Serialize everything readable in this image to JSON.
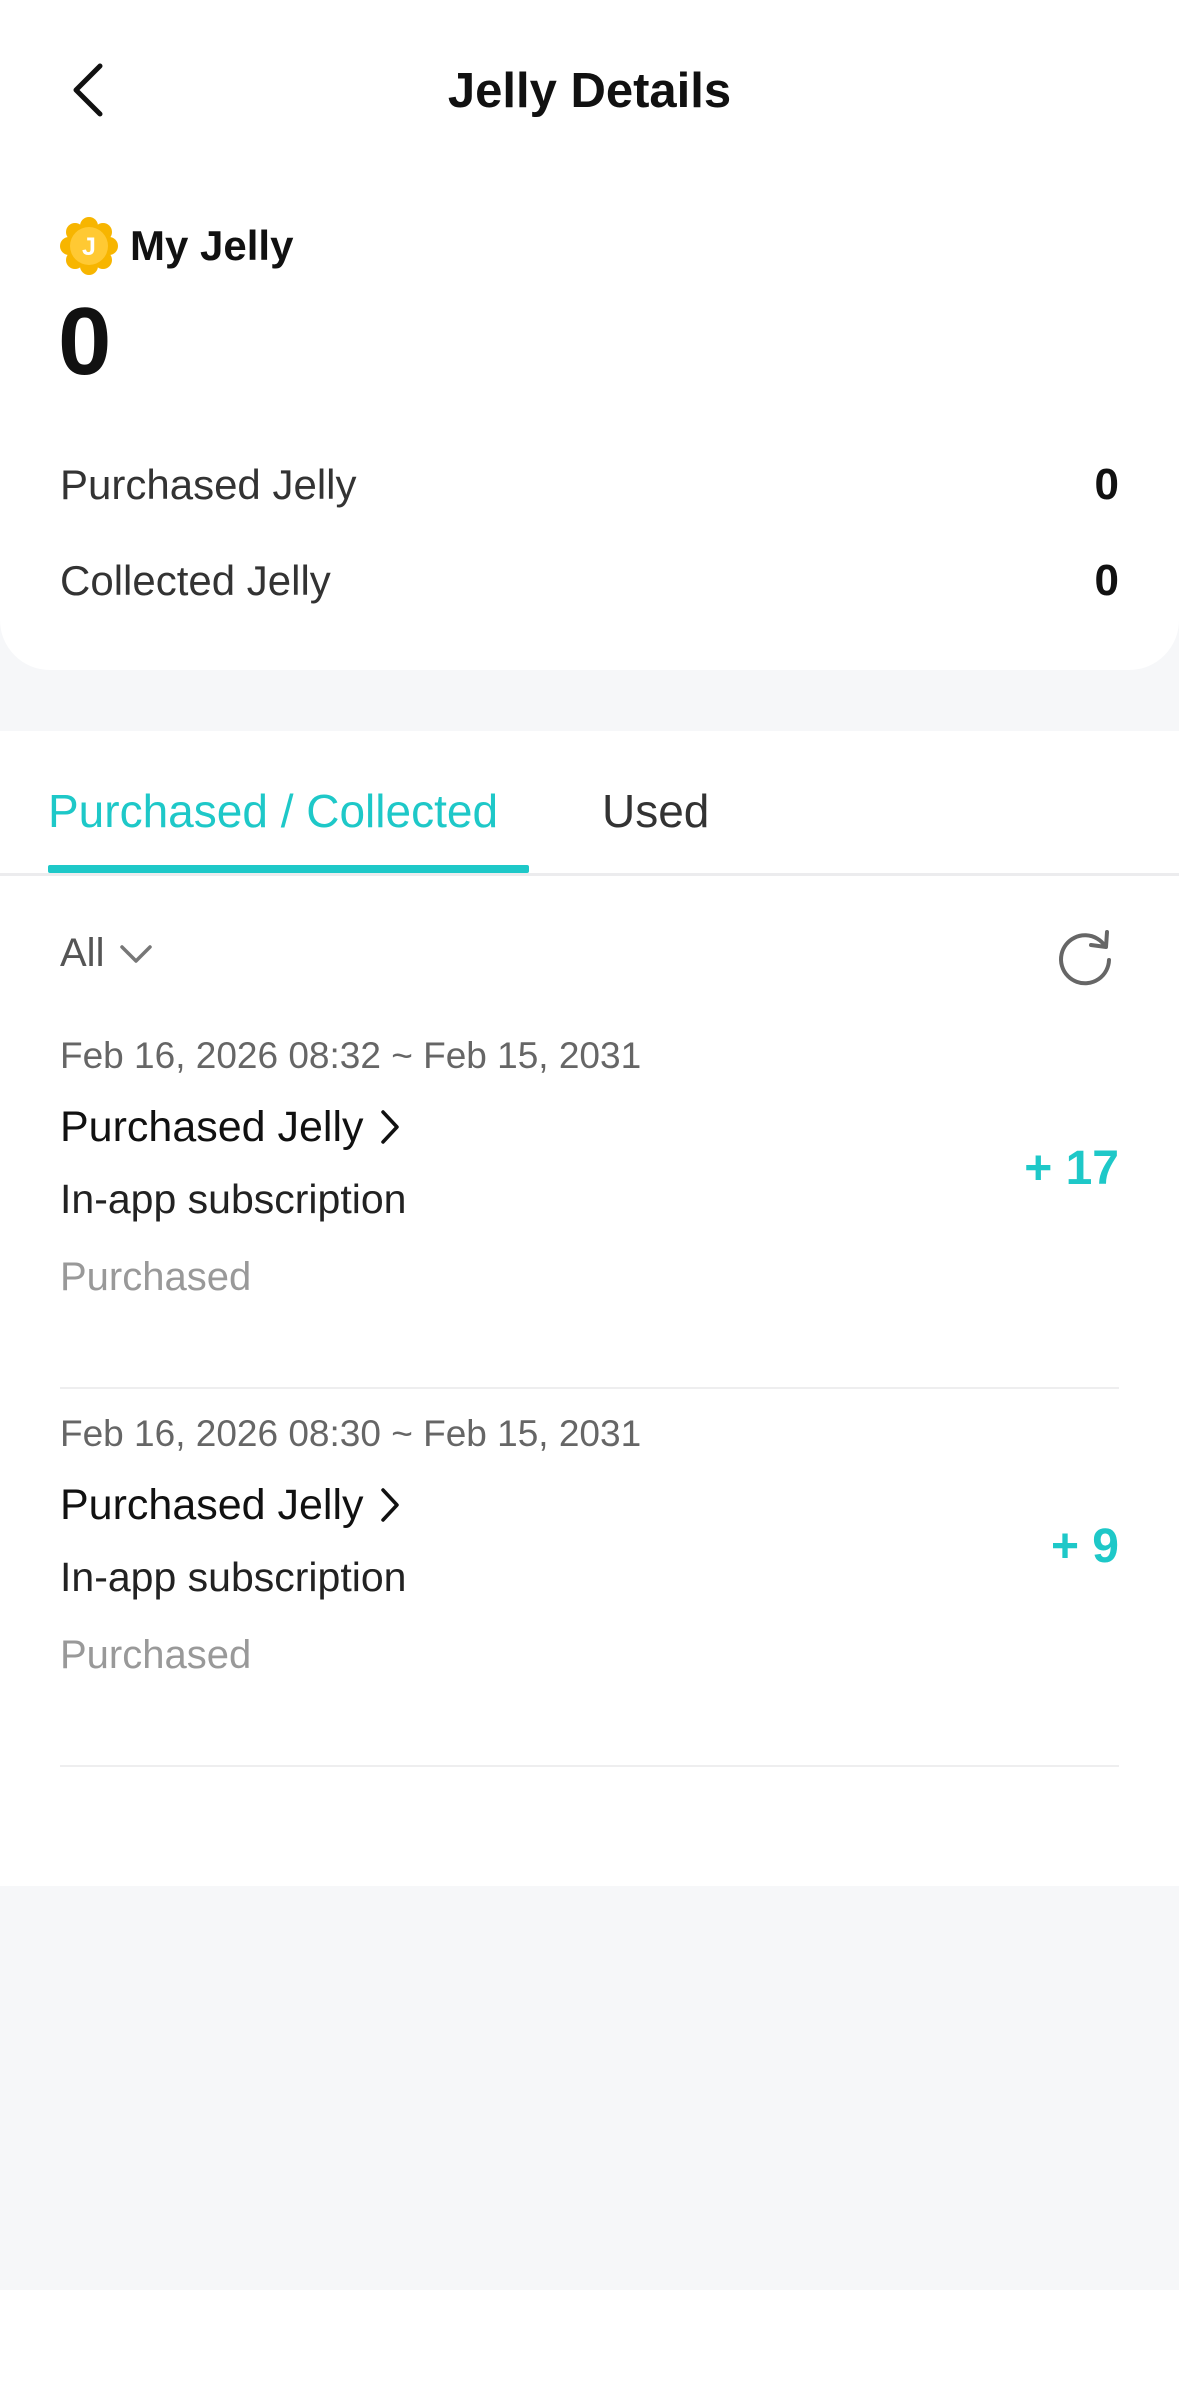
{
  "header": {
    "title": "Jelly Details",
    "back_icon": "chevron-left-icon"
  },
  "balance": {
    "label": "My Jelly",
    "coin_letter": "J",
    "total": "0",
    "rows": [
      {
        "label": "Purchased Jelly",
        "value": "0"
      },
      {
        "label": "Collected Jelly",
        "value": "0"
      }
    ]
  },
  "tabs": [
    {
      "label": "Purchased / Collected",
      "active": true
    },
    {
      "label": "Used",
      "active": false
    }
  ],
  "filter": {
    "selected": "All",
    "icon": "chevron-down-icon"
  },
  "refresh_icon": "refresh-icon",
  "records": [
    {
      "date": "Feb 16, 2026 08:32 ~ Feb 15, 2031",
      "title": "Purchased Jelly",
      "description": "In-app subscription",
      "status": "Purchased",
      "amount": "+ 17"
    },
    {
      "date": "Feb 16, 2026 08:30 ~ Feb 15, 2031",
      "title": "Purchased Jelly",
      "description": "In-app subscription",
      "status": "Purchased",
      "amount": "+ 9"
    }
  ],
  "colors": {
    "accent": "#1ec8c8",
    "coin": "#f5b400",
    "background": "#f6f7f9"
  }
}
